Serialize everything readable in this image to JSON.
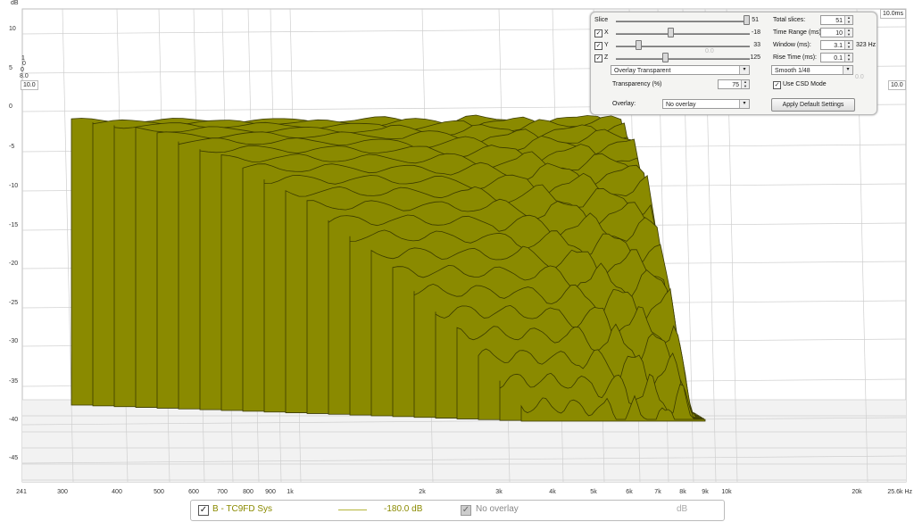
{
  "axis": {
    "y_unit": "dB",
    "x_unit": "Hz",
    "y_ticks": [
      "10",
      "5",
      "0",
      "-5",
      "-10",
      "-15",
      "-20",
      "-25",
      "-30",
      "-35",
      "-40",
      "-45"
    ],
    "x_ticks": [
      "241",
      "300",
      "400",
      "500",
      "600",
      "700",
      "800",
      "900",
      "1k",
      "2k",
      "3k",
      "4k",
      "5k",
      "6k",
      "7k",
      "8k",
      "9k",
      "10k",
      "20k",
      "25.6k Hz"
    ],
    "time_axis_end": "10.0ms",
    "left_small_labels": [
      "1",
      "0",
      "0",
      "8.0"
    ],
    "left_box_label": "10.0",
    "right_box_label": "10.0"
  },
  "colors": {
    "waterfall_fill": "#8a8a00",
    "waterfall_line": "#3a3a00",
    "legend_line": "#b5b53a",
    "legend_text": "#8a8a00"
  },
  "panel": {
    "slice_label": "Slice",
    "slice_value": "51",
    "x_label": "X",
    "x_value": "-18",
    "y_label": "Y",
    "y_value": "33",
    "z_label": "Z",
    "z_value": "125",
    "faint_value_1": "0.0",
    "faint_value_2": "0.0",
    "total_slices_label": "Total slices:",
    "total_slices_value": "51",
    "time_range_label": "Time Range (ms):",
    "time_range_value": "10",
    "window_label": "Window (ms):",
    "window_value": "3.1",
    "window_hz": "323 Hz",
    "rise_time_label": "Rise Time (ms):",
    "rise_time_value": "0.1",
    "overlay_mode": "Overlay Transparent",
    "smoothing": "Smooth 1/48",
    "transparency_label": "Transparency (%)",
    "transparency_value": "75",
    "use_csd_label": "Use CSD Mode",
    "overlay_label": "Overlay:",
    "overlay_value": "No overlay",
    "apply_button": "Apply Default Settings"
  },
  "legend": {
    "measurement_name": "B - TC9FD Sys",
    "measurement_value": "-180.0 dB",
    "overlay_name": "No overlay",
    "overlay_unit": "dB"
  },
  "chart_data": {
    "type": "area",
    "title": "",
    "xlabel": "Hz",
    "ylabel": "dB",
    "xlim": [
      241,
      25600
    ],
    "ylim": [
      -45,
      10
    ],
    "x_scale": "log",
    "time_range_ms": [
      0,
      10.0
    ],
    "slices": 51,
    "grid": true,
    "series_rendering": "stacked waterfall (cumulative spectral decay) slices, olive fill with dark outlines",
    "x": [
      241,
      320,
      500,
      800,
      1000,
      2000,
      3000,
      5000,
      7000,
      9000
    ],
    "series": [
      {
        "values": [
          -2,
          -1,
          0,
          0.5,
          0.5,
          0,
          -1,
          -3,
          -6,
          -35
        ]
      }
    ]
  }
}
